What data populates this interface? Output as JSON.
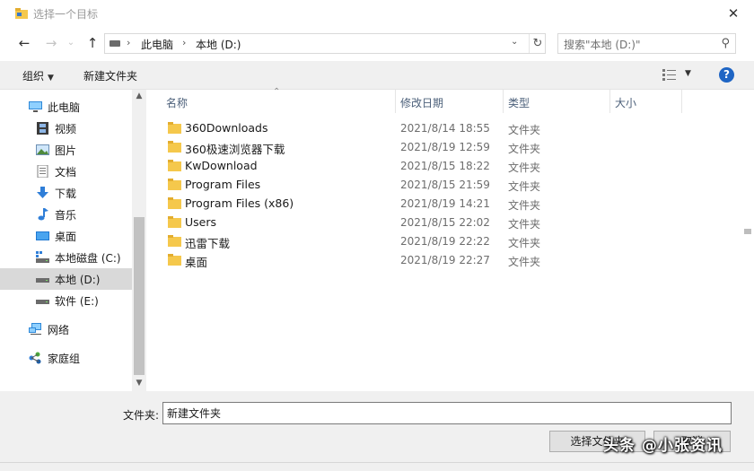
{
  "window": {
    "title": "选择一个目标",
    "close_label": "✕"
  },
  "address": {
    "segments": [
      "此电脑",
      "本地 (D:)"
    ],
    "search_placeholder": "搜索\"本地 (D:)\""
  },
  "toolbar": {
    "organize_label": "组织",
    "new_folder_label": "新建文件夹",
    "help_label": "?"
  },
  "nav": {
    "items": [
      {
        "label": "此电脑",
        "icon": "pc-icon"
      },
      {
        "label": "视频",
        "icon": "video-icon"
      },
      {
        "label": "图片",
        "icon": "pictures-icon"
      },
      {
        "label": "文档",
        "icon": "documents-icon"
      },
      {
        "label": "下载",
        "icon": "download-icon"
      },
      {
        "label": "音乐",
        "icon": "music-icon"
      },
      {
        "label": "桌面",
        "icon": "desktop-icon"
      },
      {
        "label": "本地磁盘 (C:)",
        "icon": "drive-c-icon"
      },
      {
        "label": "本地 (D:)",
        "icon": "drive-icon",
        "selected": true
      },
      {
        "label": "软件 (E:)",
        "icon": "drive-icon"
      },
      {
        "label": "网络",
        "icon": "network-icon"
      },
      {
        "label": "家庭组",
        "icon": "homegroup-icon"
      }
    ]
  },
  "list": {
    "columns": [
      "名称",
      "修改日期",
      "类型",
      "大小"
    ],
    "rows": [
      {
        "name": "360Downloads",
        "date": "2021/8/14 18:55",
        "type": "文件夹"
      },
      {
        "name": "360极速浏览器下载",
        "date": "2021/8/19 12:59",
        "type": "文件夹"
      },
      {
        "name": "KwDownload",
        "date": "2021/8/15 18:22",
        "type": "文件夹"
      },
      {
        "name": "Program Files",
        "date": "2021/8/15 21:59",
        "type": "文件夹"
      },
      {
        "name": "Program Files (x86)",
        "date": "2021/8/19 14:21",
        "type": "文件夹"
      },
      {
        "name": "Users",
        "date": "2021/8/15 22:02",
        "type": "文件夹"
      },
      {
        "name": "迅雷下载",
        "date": "2021/8/19 22:22",
        "type": "文件夹"
      },
      {
        "name": "桌面",
        "date": "2021/8/19 22:27",
        "type": "文件夹"
      }
    ]
  },
  "footer": {
    "folder_label": "文件夹:",
    "folder_value": "新建文件夹",
    "select_button": "选择文件夹",
    "cancel_button": "取消"
  },
  "watermark": "头条 @小张资讯",
  "colors": {
    "accent": "#1f65c4",
    "folder": "#f5c84c",
    "selected_nav": "#d9d9d9"
  }
}
